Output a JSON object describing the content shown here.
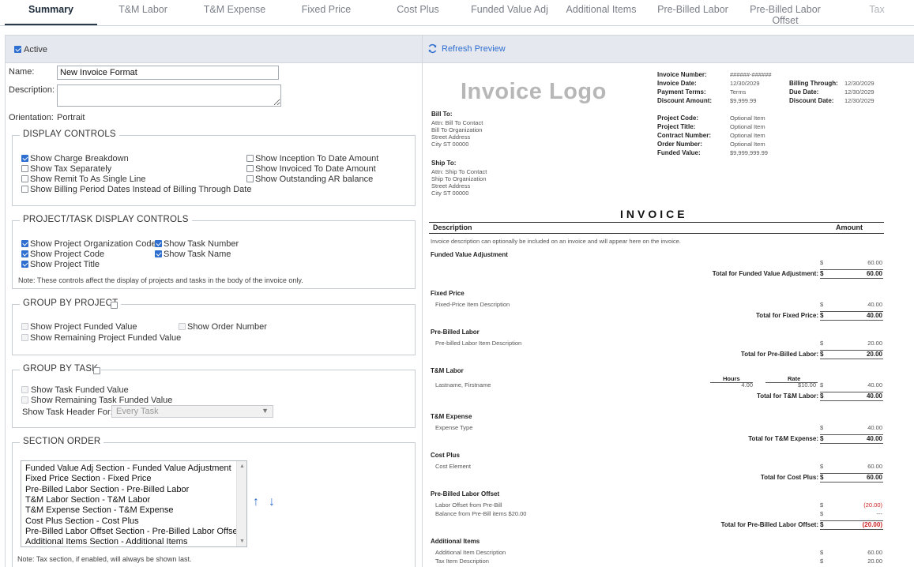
{
  "tabs": [
    {
      "label": "Summary",
      "active": true
    },
    {
      "label": "T&M Labor"
    },
    {
      "label": "T&M Expense"
    },
    {
      "label": "Fixed Price"
    },
    {
      "label": "Cost Plus"
    },
    {
      "label": "Funded Value Adj"
    },
    {
      "label": "Additional Items"
    },
    {
      "label": "Pre-Billed Labor"
    },
    {
      "label": "Pre-Billed Labor Offset"
    },
    {
      "label": "Tax"
    }
  ],
  "settings": {
    "active_label": "Active",
    "active_checked": true,
    "name_label": "Name:",
    "name_value": "New Invoice Format",
    "description_label": "Description:",
    "description_value": "",
    "orientation_label": "Orientation:",
    "orientation_value": "Portrait"
  },
  "display_controls": {
    "legend": "DISPLAY CONTROLS",
    "items": [
      {
        "label": "Show Charge Breakdown",
        "checked": true
      },
      {
        "label": "Show Tax Separately",
        "checked": false
      },
      {
        "label": "Show Remit To As Single Line",
        "checked": false
      },
      {
        "label": "Show Billing Period Dates Instead of Billing Through Date",
        "checked": false
      },
      {
        "label": "Show Inception To Date Amount",
        "checked": false
      },
      {
        "label": "Show Invoiced To Date Amount",
        "checked": false
      },
      {
        "label": "Show Outstanding AR balance",
        "checked": false
      }
    ]
  },
  "project_task_controls": {
    "legend": "PROJECT/TASK DISPLAY CONTROLS",
    "items": [
      {
        "label": "Show Project Organization Code",
        "checked": true
      },
      {
        "label": "Show Project Code",
        "checked": true
      },
      {
        "label": "Show Project Title",
        "checked": true
      },
      {
        "label": "Show Task Number",
        "checked": true
      },
      {
        "label": "Show Task Name",
        "checked": true
      }
    ],
    "note": "Note: These controls affect the display of projects and tasks in the body of the invoice only."
  },
  "group_by_project": {
    "legend": "GROUP BY PROJECT",
    "checked": false,
    "items": [
      {
        "label": "Show Project Funded Value"
      },
      {
        "label": "Show Remaining Project Funded Value"
      },
      {
        "label": "Show Order Number"
      }
    ]
  },
  "group_by_task": {
    "legend": "GROUP BY TASK",
    "checked": false,
    "items": [
      {
        "label": "Show Task Funded Value"
      },
      {
        "label": "Show Remaining Task Funded Value"
      }
    ],
    "header_label": "Show Task Header For:",
    "header_value": "Every Task"
  },
  "section_order": {
    "legend": "SECTION ORDER",
    "items": [
      "Funded Value Adj Section - Funded Value Adjustment",
      "Fixed Price Section - Fixed Price",
      "Pre-Billed Labor Section - Pre-Billed Labor",
      "T&M Labor Section - T&M Labor",
      "T&M Expense Section - T&M Expense",
      "Cost Plus Section - Cost Plus",
      "Pre-Billed Labor Offset Section - Pre-Billed Labor Offset",
      "Additional Items Section - Additional Items"
    ],
    "up_arrow": "↑",
    "down_arrow": "↓",
    "note": "Note: Tax section, if enabled, will always be shown last."
  },
  "preview": {
    "refresh_label": "Refresh Preview",
    "logo_text": "Invoice Logo",
    "header_fields": [
      {
        "label": "Invoice Number:",
        "value": "######-######"
      },
      {
        "label": "Invoice Date:",
        "value": "12/30/2029"
      },
      {
        "label": "Payment Terms:",
        "value": "Terms"
      },
      {
        "label": "Discount Amount:",
        "value": "$9,999.99"
      }
    ],
    "header_fields_right": [
      {
        "label": "Billing Through:",
        "value": "12/30/2029"
      },
      {
        "label": "Due Date:",
        "value": "12/30/2029"
      },
      {
        "label": "Discount Date:",
        "value": "12/30/2029"
      }
    ],
    "project_fields": [
      {
        "label": "Project Code:",
        "value": "Optional Item"
      },
      {
        "label": "Project Title:",
        "value": "Optional Item"
      },
      {
        "label": "Contract Number:",
        "value": "Optional Item"
      },
      {
        "label": "Order Number:",
        "value": "Optional Item"
      },
      {
        "label": "Funded Value:",
        "value": "$9,999,999.99"
      }
    ],
    "bill_to": {
      "title": "Bill To:",
      "lines": [
        "Attn: Bill To Contact",
        "Bill To Organization",
        "Street Address",
        "City ST 00000"
      ]
    },
    "ship_to": {
      "title": "Ship To:",
      "lines": [
        "Attn: Ship To Contact",
        "Ship To Organization",
        "Street Address",
        "City ST 00000"
      ]
    },
    "invoice_title": "INVOICE",
    "col_description": "Description",
    "col_amount": "Amount",
    "description_note": "Invoice description can optionally be included on an invoice and will appear here on the invoice.",
    "currency": "$",
    "hours_label": "Hours",
    "rate_label": "Rate",
    "sections": [
      {
        "title": "Funded Value Adjustment",
        "items": [
          {
            "desc": "",
            "amount": "60.00"
          }
        ],
        "total_label": "Total for Funded Value Adjustment:",
        "total": "60.00"
      },
      {
        "title": "Fixed Price",
        "items": [
          {
            "desc": "Fixed-Price Item Description",
            "amount": "40.00"
          }
        ],
        "total_label": "Total for Fixed Price:",
        "total": "40.00"
      },
      {
        "title": "Pre-Billed Labor",
        "items": [
          {
            "desc": "Pre-billed Labor Item Description",
            "amount": "20.00"
          }
        ],
        "total_label": "Total for Pre-Billed Labor:",
        "total": "20.00"
      },
      {
        "title": "T&M Labor",
        "items": [
          {
            "desc": "Lastname, Firstname",
            "hours": "4.00",
            "rate": "$10.00",
            "amount": "40.00"
          }
        ],
        "total_label": "Total for T&M Labor:",
        "total": "40.00"
      },
      {
        "title": "T&M Expense",
        "items": [
          {
            "desc": "Expense Type",
            "amount": "40.00"
          }
        ],
        "total_label": "Total for T&M Expense:",
        "total": "40.00"
      },
      {
        "title": "Cost Plus",
        "items": [
          {
            "desc": "Cost Element",
            "amount": "60.00"
          }
        ],
        "total_label": "Total for Cost Plus:",
        "total": "60.00"
      },
      {
        "title": "Pre-Billed Labor Offset",
        "items": [
          {
            "desc": "Labor Offset from Pre-Bill",
            "amount": "(20.00)"
          },
          {
            "desc": "Balance from Pre-Bill items $20.00",
            "amount": "---"
          }
        ],
        "total_label": "Total for Pre-Billed Labor Offset:",
        "total": "(20.00)"
      },
      {
        "title": "Additional Items",
        "items": [
          {
            "desc": "Additional Item Description",
            "amount": "60.00"
          },
          {
            "desc": "Tax Item Description",
            "amount": "20.00"
          }
        ],
        "total_label": "",
        "total": ""
      }
    ]
  },
  "colors": {
    "accent": "#2f6fd0",
    "negative": "#cc2222",
    "panel_header": "#e6e8f0"
  }
}
